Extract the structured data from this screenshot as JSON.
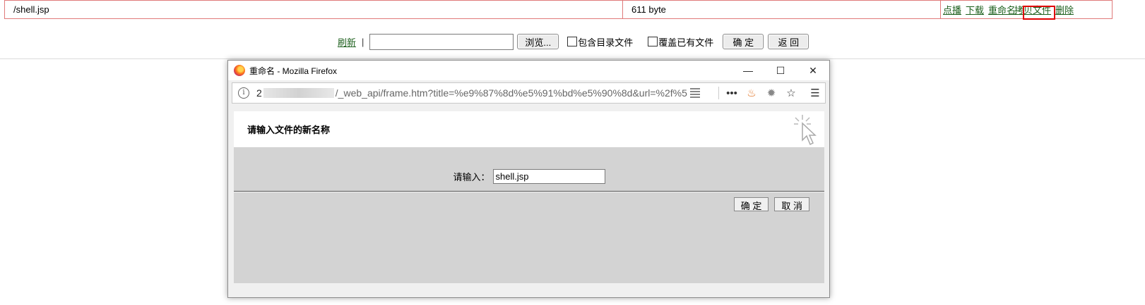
{
  "file_row": {
    "name": "/shell.jsp",
    "size": "611 byte",
    "actions": [
      "点播",
      "下载",
      "重命名",
      "拷贝文件",
      "删除"
    ]
  },
  "toolbar": {
    "refresh": "刷新",
    "separator": "|",
    "browse": "浏览...",
    "include_dirs": "包含目录文件",
    "overwrite": "覆盖已有文件",
    "confirm": "确 定",
    "back": "返 回"
  },
  "popup": {
    "window_title": "重命名 - Mozilla Firefox",
    "url_host": "2",
    "url_rest": "/_web_api/frame.htm?title=%e9%87%8d%e5%91%bd%e5%90%8d&url=%2f%5",
    "heading": "请输入文件的新名称",
    "input_label": "请输入：",
    "input_value": "shell.jsp",
    "ok": "确 定",
    "cancel": "取 消"
  },
  "colors": {
    "table_border": "#e07a7a",
    "link": "#1b5e1b",
    "highlight": "#e00000",
    "content_bg": "#d3d3d3"
  }
}
